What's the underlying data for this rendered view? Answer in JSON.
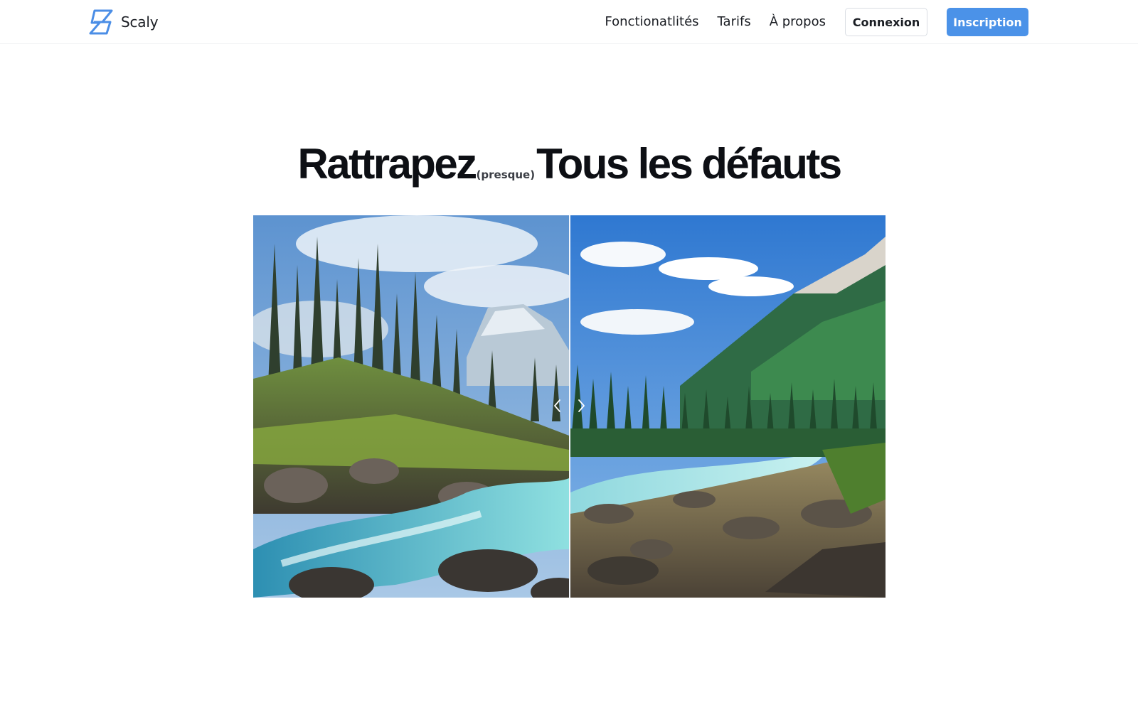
{
  "header": {
    "brand": "Scaly",
    "brand_icon": "lightning-s-logo-icon",
    "nav": [
      {
        "label": "Fonctionatlités"
      },
      {
        "label": "Tarifs"
      },
      {
        "label": "À propos"
      }
    ],
    "login_label": "Connexion",
    "signup_label": "Inscription"
  },
  "hero": {
    "title_part1": "Rattrapez",
    "title_small": "(presque)",
    "title_part2": "Tous les défauts"
  },
  "comparison": {
    "left_label_icon": "chevron-left-icon",
    "right_label_icon": "chevron-right-icon",
    "split_fraction": 0.5
  },
  "colors": {
    "accent": "#4b92e8",
    "text": "#0d0f14",
    "border": "#d9dde3"
  }
}
